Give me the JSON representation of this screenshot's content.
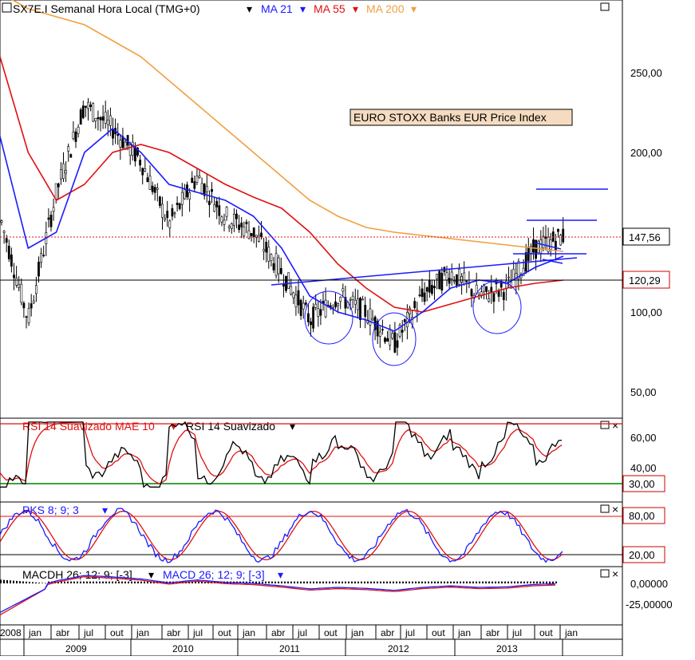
{
  "header": {
    "symbol": "SX7E.I Semanal Hora Local (TMG+0)",
    "ma21": "MA 21",
    "ma55": "MA 55",
    "ma200": "MA 200"
  },
  "price_panel": {
    "annotation": "EURO STOXX Banks EUR Price Index",
    "last_price_label": "147,56",
    "support_label": "120,29",
    "y_ticks": [
      "250,00",
      "200,00",
      "100,00",
      "50,00"
    ]
  },
  "rsi_panel": {
    "title_1": "RSI 14 Suavizado MAE 10",
    "title_2": "RSI 14 Suavizado",
    "y_ticks": [
      "60,00",
      "40,00"
    ],
    "level_label": "30,00"
  },
  "pks_panel": {
    "title": "PKS 8; 9; 3",
    "upper_label": "80,00",
    "lower_label": "20,00"
  },
  "macd_panel": {
    "title_1": "MACDH 26; 12; 9; [-3]",
    "title_2": "MACD 26; 12; 9; [-3]",
    "y_ticks": [
      "0,00000",
      "-25,00000"
    ]
  },
  "x_axis": {
    "months": [
      "2008",
      "jan",
      "abr",
      "jul",
      "out",
      "jan",
      "abr",
      "jul",
      "out",
      "jan",
      "abr",
      "jul",
      "out",
      "jan",
      "abr",
      "jul",
      "out",
      "jan",
      "abr",
      "jul",
      "out",
      "jan"
    ],
    "years": [
      "2009",
      "2010",
      "2011",
      "2012",
      "2013"
    ]
  },
  "colors": {
    "price": "#000000",
    "ma21": "#1a1aff",
    "ma55": "#e01010",
    "ma200": "#f0a040",
    "green": "#008000",
    "label_bg": "#f5dcc0"
  },
  "chart_data": {
    "type": "line",
    "title": "SX7E.I Semanal Hora Local (TMG+0)",
    "x": [
      "2008-12",
      "2009-03",
      "2009-06",
      "2009-09",
      "2009-12",
      "2010-03",
      "2010-06",
      "2010-09",
      "2010-12",
      "2011-03",
      "2011-06",
      "2011-09",
      "2011-12",
      "2012-03",
      "2012-06",
      "2012-09",
      "2012-12",
      "2013-03",
      "2013-06",
      "2013-09",
      "2013-11"
    ],
    "series": [
      {
        "name": "SX7E.I",
        "values": [
          160,
          95,
          175,
          230,
          215,
          195,
          155,
          185,
          160,
          150,
          125,
          95,
          110,
          100,
          80,
          110,
          125,
          110,
          115,
          140,
          147.56
        ]
      },
      {
        "name": "MA 21",
        "values": [
          210,
          140,
          150,
          200,
          215,
          200,
          180,
          175,
          170,
          160,
          140,
          110,
          100,
          95,
          88,
          100,
          115,
          120,
          118,
          128,
          135
        ]
      },
      {
        "name": "MA 55",
        "values": [
          260,
          200,
          170,
          180,
          200,
          205,
          200,
          190,
          180,
          172,
          165,
          150,
          130,
          115,
          103,
          100,
          105,
          110,
          115,
          118,
          120
        ]
      },
      {
        "name": "MA 200",
        "values": [
          300,
          290,
          285,
          280,
          270,
          260,
          245,
          230,
          215,
          200,
          185,
          170,
          160,
          153,
          150,
          148,
          146,
          144,
          142,
          140,
          138
        ]
      }
    ],
    "ylim": [
      30,
      295
    ],
    "levels": {
      "last": 147.56,
      "support": 120.29
    }
  }
}
